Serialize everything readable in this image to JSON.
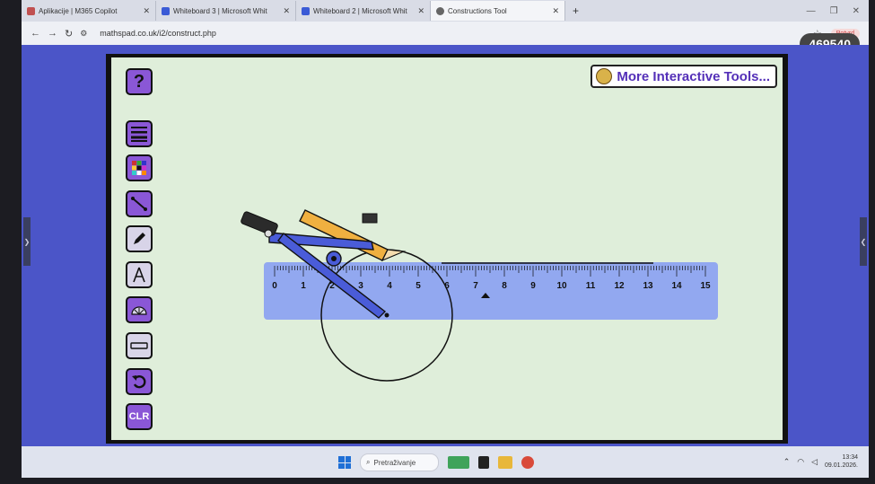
{
  "browser": {
    "tabs": [
      {
        "title": "Aplikacije | M365 Copilot",
        "fav_color": "#c05050"
      },
      {
        "title": "Whiteboard 3 | Microsoft Whit",
        "fav_color": "#3b5bd6"
      },
      {
        "title": "Whiteboard 2 | Microsoft Whit",
        "fav_color": "#3b5bd6"
      },
      {
        "title": "Constructions Tool",
        "fav_color": "#666666"
      }
    ],
    "new_tab": "+",
    "url": "mathspad.co.uk/i2/construct.php",
    "profile_label": "Potvrd",
    "badge": "469540"
  },
  "app": {
    "help_label": "?",
    "clear_label": "CLR",
    "more_tools_label": "More Interactive Tools...",
    "tools": [
      {
        "name": "line-width-tool",
        "icon": "lines-icon"
      },
      {
        "name": "color-palette-tool",
        "icon": "palette-icon"
      },
      {
        "name": "line-segment-tool",
        "icon": "segment-icon"
      },
      {
        "name": "pencil-tool",
        "icon": "pencil-icon"
      },
      {
        "name": "compass-tool",
        "icon": "compass-icon"
      },
      {
        "name": "protractor-tool",
        "icon": "protractor-icon"
      },
      {
        "name": "ruler-tool",
        "icon": "ruler-icon"
      },
      {
        "name": "undo-tool",
        "icon": "undo-icon"
      }
    ],
    "ruler_labels": [
      "0",
      "1",
      "2",
      "3",
      "4",
      "5",
      "6",
      "7",
      "8",
      "9",
      "10",
      "11",
      "12",
      "13",
      "14",
      "15"
    ],
    "colors": {
      "canvas": "#dfeeda",
      "tool": "#8a57d6",
      "ruler": "#8aa0f2",
      "compass": "#4a5cd8",
      "pencil": "#f0b040"
    }
  },
  "taskbar": {
    "search_placeholder": "Pretraživanje",
    "time": "13:34",
    "date": "09.01.2026."
  }
}
